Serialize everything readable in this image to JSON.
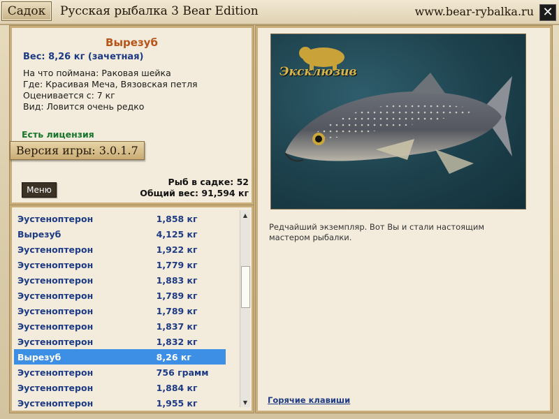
{
  "window": {
    "sadok_label": "Садок",
    "title": "Русская рыбалка 3 Bear Edition",
    "site_url": "www.bear-rybalka.ru",
    "close_symbol": "✕"
  },
  "fish": {
    "name": "Вырезуб",
    "weight": "Вес: 8,26 кг (зачетная)",
    "details": [
      "На что поймана: Раковая шейка",
      "Где: Красивая Меча, Вязовская петля",
      "Оценивается с: 7 кг",
      "Вид: Ловится очень редко"
    ],
    "license": "Есть лицензия",
    "badge_text": "Эксклюзив"
  },
  "version": "Версия игры: 3.0.1.7",
  "menu_label": "Меню",
  "stats": {
    "fish_count": "Рыб в садке: 52",
    "total_weight": "Общий вес: 91,594 кг"
  },
  "catch_list": [
    {
      "name": "Эустеноптерон",
      "weight": "1,858 кг",
      "selected": false
    },
    {
      "name": "Вырезуб",
      "weight": "4,125 кг",
      "selected": false
    },
    {
      "name": "Эустеноптерон",
      "weight": "1,922 кг",
      "selected": false
    },
    {
      "name": "Эустеноптерон",
      "weight": "1,779 кг",
      "selected": false
    },
    {
      "name": "Эустеноптерон",
      "weight": "1,883 кг",
      "selected": false
    },
    {
      "name": "Эустеноптерон",
      "weight": "1,789 кг",
      "selected": false
    },
    {
      "name": "Эустеноптерон",
      "weight": "1,789 кг",
      "selected": false
    },
    {
      "name": "Эустеноптерон",
      "weight": "1,837 кг",
      "selected": false
    },
    {
      "name": "Эустеноптерон",
      "weight": "1,832 кг",
      "selected": false
    },
    {
      "name": "Вырезуб",
      "weight": "8,26 кг",
      "selected": true
    },
    {
      "name": "Эустеноптерон",
      "weight": "756 грамм",
      "selected": false
    },
    {
      "name": "Эустеноптерон",
      "weight": "1,884 кг",
      "selected": false
    },
    {
      "name": "Эустеноптерон",
      "weight": "1,955 кг",
      "selected": false
    }
  ],
  "description": "Редчайший экземпляр. Вот Вы и стали настоящим мастером рыбалки.",
  "hotkeys_label": "Горячие клавиши",
  "colors": {
    "selected_row": "#3d8fe6",
    "fish_name": "#b8541a",
    "link": "#1d3a85",
    "license": "#16752a"
  }
}
